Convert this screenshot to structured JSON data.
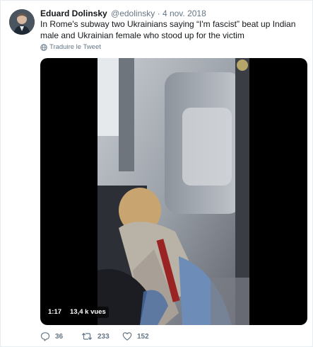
{
  "tweet": {
    "name": "Eduard Dolinsky",
    "handle": "@edolinsky",
    "separator": "·",
    "date": "4 nov. 2018",
    "text": "In Rome's subway two Ukrainians saying “I'm fascist” beat up Indian male and Ukrainian female who stood up for the victim",
    "translate_label": "Traduire le Tweet"
  },
  "video": {
    "duration": "1:17",
    "views": "13,4 k vues"
  },
  "actions": {
    "replies": "36",
    "retweets": "233",
    "likes": "152"
  },
  "icons": {
    "translate": "globe-icon",
    "reply": "reply-icon",
    "retweet": "retweet-icon",
    "like": "heart-icon"
  },
  "colors": {
    "name": "#14171a",
    "secondary": "#657786",
    "border": "#e6ecf0"
  }
}
